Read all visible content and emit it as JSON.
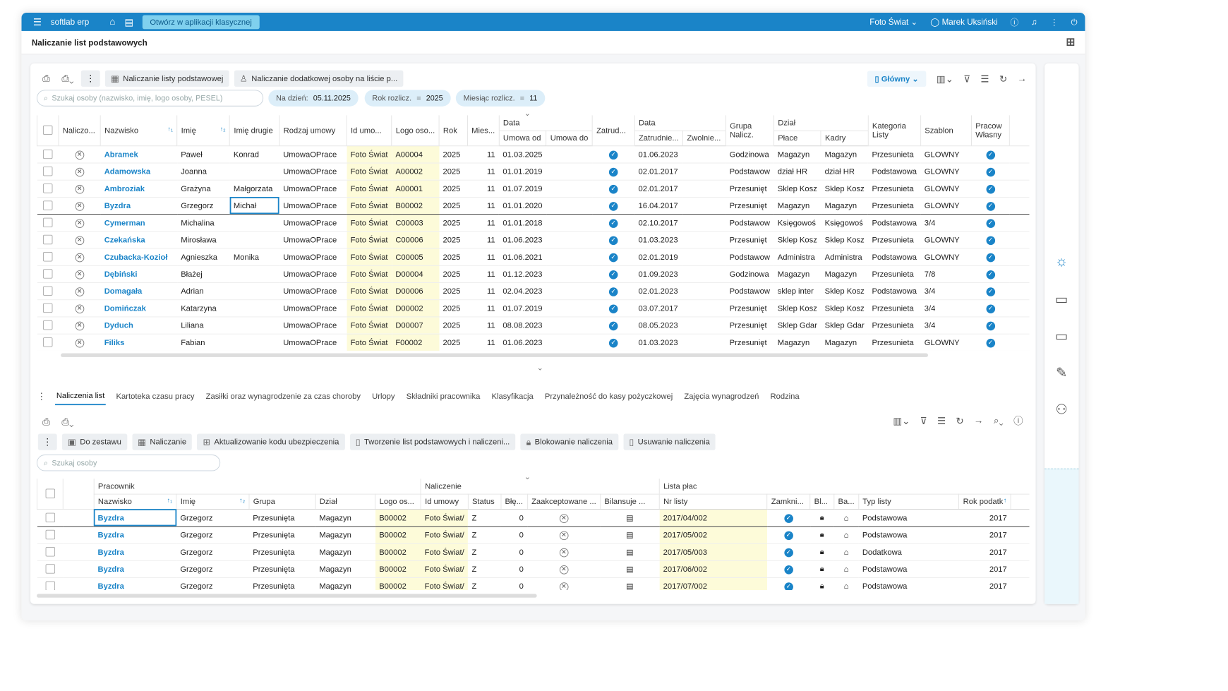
{
  "topbar": {
    "logo": "softlab erp",
    "classic_button": "Otwórz w aplikacji klasycznej",
    "company": "Foto Świat",
    "user": "Marek Uksiński"
  },
  "page": {
    "title": "Naliczanie list podstawowych"
  },
  "top_toolbar": {
    "btn1": "Naliczanie listy podstawowej",
    "btn2": "Naliczanie dodatkowej osoby na liście p...",
    "view": "Główny"
  },
  "filters": {
    "search_placeholder": "Szukaj osoby (nazwisko, imię, logo osoby, PESEL)",
    "day_label": "Na dzień:",
    "day_value": "05.11.2025",
    "year_label": "Rok rozlicz.",
    "year_op": "=",
    "year_value": "2025",
    "month_label": "Miesiąc rozlicz.",
    "month_op": "=",
    "month_value": "11"
  },
  "grid1": {
    "headers": {
      "nalicz": "Naliczo...",
      "nazwisko": "Nazwisko",
      "imie": "Imię",
      "imie2": "Imię drugie",
      "rodzaj": "Rodzaj umowy",
      "idumo": "Id umo...",
      "logo": "Logo oso...",
      "rok": "Rok",
      "mies": "Mies...",
      "data": "Data",
      "umowa_od": "Umowa od",
      "umowa_do": "Umowa do",
      "zatrud": "Zatrud...",
      "data2": "Data",
      "zatrudnie": "Zatrudnie...",
      "zwolnie": "Zwolnie...",
      "grupa": "Grupa Nalicz.",
      "dzial": "Dział",
      "place": "Płace",
      "kadry": "Kadry",
      "kategoria": "Kategoria Listy",
      "szablon": "Szablon",
      "pracow": "Pracow Własny"
    },
    "rows": [
      {
        "nazwisko": "Abramek",
        "imie": "Paweł",
        "imie2": "Konrad",
        "rodzaj": "UmowaOPrace",
        "idumo": "Foto Świat",
        "logo": "A00004",
        "rok": "2025",
        "mies": "11",
        "od": "01.03.2025",
        "zatr": "01.06.2023",
        "grupa": "Godzinowa",
        "place": "Magazyn",
        "kadry": "Magazyn",
        "kat": "Przesunieta",
        "szablon": "GLOWNY"
      },
      {
        "nazwisko": "Adamowska",
        "imie": "Joanna",
        "imie2": "",
        "rodzaj": "UmowaOPrace",
        "idumo": "Foto Świat",
        "logo": "A00002",
        "rok": "2025",
        "mies": "11",
        "od": "01.01.2019",
        "zatr": "02.01.2017",
        "grupa": "Podstawow",
        "place": "dział HR",
        "kadry": "dział HR",
        "kat": "Podstawowa",
        "szablon": "GLOWNY"
      },
      {
        "nazwisko": "Ambroziak",
        "imie": "Grażyna",
        "imie2": "Małgorzata",
        "rodzaj": "UmowaOPrace",
        "idumo": "Foto Świat",
        "logo": "A00001",
        "rok": "2025",
        "mies": "11",
        "od": "01.07.2019",
        "zatr": "02.01.2017",
        "grupa": "Przesunięt",
        "place": "Sklep Kosz",
        "kadry": "Sklep Kosz",
        "kat": "Przesunieta",
        "szablon": "GLOWNY"
      },
      {
        "nazwisko": "Byzdra",
        "imie": "Grzegorz",
        "imie2": "Michał",
        "rodzaj": "UmowaOPrace",
        "idumo": "Foto Świat",
        "logo": "B00002",
        "rok": "2025",
        "mies": "11",
        "od": "01.01.2020",
        "zatr": "16.04.2017",
        "grupa": "Przesunięt",
        "place": "Magazyn",
        "kadry": "Magazyn",
        "kat": "Przesunieta",
        "szablon": "GLOWNY"
      },
      {
        "nazwisko": "Cymerman",
        "imie": "Michalina",
        "imie2": "",
        "rodzaj": "UmowaOPrace",
        "idumo": "Foto Świat",
        "logo": "C00003",
        "rok": "2025",
        "mies": "11",
        "od": "01.01.2018",
        "zatr": "02.10.2017",
        "grupa": "Podstawow",
        "place": "Księgowoś",
        "kadry": "Księgowoś",
        "kat": "Podstawowa",
        "szablon": "3/4"
      },
      {
        "nazwisko": "Czekańska",
        "imie": "Mirosława",
        "imie2": "",
        "rodzaj": "UmowaOPrace",
        "idumo": "Foto Świat",
        "logo": "C00006",
        "rok": "2025",
        "mies": "11",
        "od": "01.06.2023",
        "zatr": "01.03.2023",
        "grupa": "Przesunięt",
        "place": "Sklep Kosz",
        "kadry": "Sklep Kosz",
        "kat": "Przesunieta",
        "szablon": "GLOWNY"
      },
      {
        "nazwisko": "Czubacka-Kozioł",
        "imie": "Agnieszka",
        "imie2": "Monika",
        "rodzaj": "UmowaOPrace",
        "idumo": "Foto Świat",
        "logo": "C00005",
        "rok": "2025",
        "mies": "11",
        "od": "01.06.2021",
        "zatr": "02.01.2019",
        "grupa": "Podstawow",
        "place": "Administra",
        "kadry": "Administra",
        "kat": "Podstawowa",
        "szablon": "GLOWNY"
      },
      {
        "nazwisko": "Dębiński",
        "imie": "Błażej",
        "imie2": "",
        "rodzaj": "UmowaOPrace",
        "idumo": "Foto Świat",
        "logo": "D00004",
        "rok": "2025",
        "mies": "11",
        "od": "01.12.2023",
        "zatr": "01.09.2023",
        "grupa": "Godzinowa",
        "place": "Magazyn",
        "kadry": "Magazyn",
        "kat": "Przesunieta",
        "szablon": "7/8"
      },
      {
        "nazwisko": "Domagała",
        "imie": "Adrian",
        "imie2": "",
        "rodzaj": "UmowaOPrace",
        "idumo": "Foto Świat",
        "logo": "D00006",
        "rok": "2025",
        "mies": "11",
        "od": "02.04.2023",
        "zatr": "02.01.2023",
        "grupa": "Podstawow",
        "place": "sklep inter",
        "kadry": "Sklep Kosz",
        "kat": "Podstawowa",
        "szablon": "3/4"
      },
      {
        "nazwisko": "Domińczak",
        "imie": "Katarzyna",
        "imie2": "",
        "rodzaj": "UmowaOPrace",
        "idumo": "Foto Świat",
        "logo": "D00002",
        "rok": "2025",
        "mies": "11",
        "od": "01.07.2019",
        "zatr": "03.07.2017",
        "grupa": "Przesunięt",
        "place": "Sklep Kosz",
        "kadry": "Sklep Kosz",
        "kat": "Przesunieta",
        "szablon": "3/4"
      },
      {
        "nazwisko": "Dyduch",
        "imie": "Liliana",
        "imie2": "",
        "rodzaj": "UmowaOPrace",
        "idumo": "Foto Świat",
        "logo": "D00007",
        "rok": "2025",
        "mies": "11",
        "od": "08.08.2023",
        "zatr": "08.05.2023",
        "grupa": "Przesunięt",
        "place": "Sklep Gdar",
        "kadry": "Sklep Gdar",
        "kat": "Przesunieta",
        "szablon": "3/4"
      },
      {
        "nazwisko": "Filiks",
        "imie": "Fabian",
        "imie2": "",
        "rodzaj": "UmowaOPrace",
        "idumo": "Foto Świat",
        "logo": "F00002",
        "rok": "2025",
        "mies": "11",
        "od": "01.06.2023",
        "zatr": "01.03.2023",
        "grupa": "Przesunięt",
        "place": "Magazyn",
        "kadry": "Magazyn",
        "kat": "Przesunieta",
        "szablon": "GLOWNY"
      }
    ]
  },
  "tabs": [
    "Naliczenia list",
    "Kartoteka czasu pracy",
    "Zasiłki oraz wynagrodzenie za czas choroby",
    "Urlopy",
    "Składniki pracownika",
    "Klasyfikacja",
    "Przynależność do kasy pożyczkowej",
    "Zajęcia wynagrodzeń",
    "Rodzina"
  ],
  "bottom_toolbar": {
    "b1": "Do zestawu",
    "b2": "Naliczanie",
    "b3": "Aktualizowanie kodu ubezpieczenia",
    "b4": "Tworzenie list podstawowych i naliczeni...",
    "b5": "Blokowanie naliczenia",
    "b6": "Usuwanie naliczenia",
    "search_placeholder": "Szukaj osoby"
  },
  "grid2": {
    "headers": {
      "pracownik": "Pracownik",
      "naliczenie": "Naliczenie",
      "lista": "Lista płac",
      "nazwisko": "Nazwisko",
      "imie": "Imię",
      "grupa": "Grupa",
      "dzial": "Dział",
      "logo": "Logo os...",
      "idumowy": "Id umowy",
      "status": "Status",
      "ble": "Błę...",
      "zaak": "Zaakceptowane ...",
      "bil": "Bilansuje ...",
      "nrlisty": "Nr listy",
      "zamkni": "Zamkni...",
      "bl": "Bl...",
      "ba": "Ba...",
      "typ": "Typ listy",
      "rok": "Rok podatk"
    },
    "rows": [
      {
        "nazwisko": "Byzdra",
        "imie": "Grzegorz",
        "grupa": "Przesunięta",
        "dzial": "Magazyn",
        "logo": "B00002",
        "idumowy": "Foto Świat/",
        "status": "Z",
        "ble": "0",
        "nr": "2017/04/002",
        "typ": "Podstawowa",
        "rok": "2017"
      },
      {
        "nazwisko": "Byzdra",
        "imie": "Grzegorz",
        "grupa": "Przesunięta",
        "dzial": "Magazyn",
        "logo": "B00002",
        "idumowy": "Foto Świat/",
        "status": "Z",
        "ble": "0",
        "nr": "2017/05/002",
        "typ": "Podstawowa",
        "rok": "2017"
      },
      {
        "nazwisko": "Byzdra",
        "imie": "Grzegorz",
        "grupa": "Przesunięta",
        "dzial": "Magazyn",
        "logo": "B00002",
        "idumowy": "Foto Świat/",
        "status": "Z",
        "ble": "0",
        "nr": "2017/05/003",
        "typ": "Dodatkowa",
        "rok": "2017"
      },
      {
        "nazwisko": "Byzdra",
        "imie": "Grzegorz",
        "grupa": "Przesunięta",
        "dzial": "Magazyn",
        "logo": "B00002",
        "idumowy": "Foto Świat/",
        "status": "Z",
        "ble": "0",
        "nr": "2017/06/002",
        "typ": "Podstawowa",
        "rok": "2017"
      },
      {
        "nazwisko": "Byzdra",
        "imie": "Grzegorz",
        "grupa": "Przesunięta",
        "dzial": "Magazyn",
        "logo": "B00002",
        "idumowy": "Foto Świat/",
        "status": "Z",
        "ble": "0",
        "nr": "2017/07/002",
        "typ": "Podstawowa",
        "rok": "2017"
      }
    ]
  },
  "icons": {
    "menu": "hamburger-icon",
    "home": "home-icon",
    "power": "power-icon",
    "check": "check-circle-icon",
    "x": "x-circle-icon"
  },
  "colors": {
    "primary": "#1a84c8",
    "highlight": "#fdfbd9"
  }
}
